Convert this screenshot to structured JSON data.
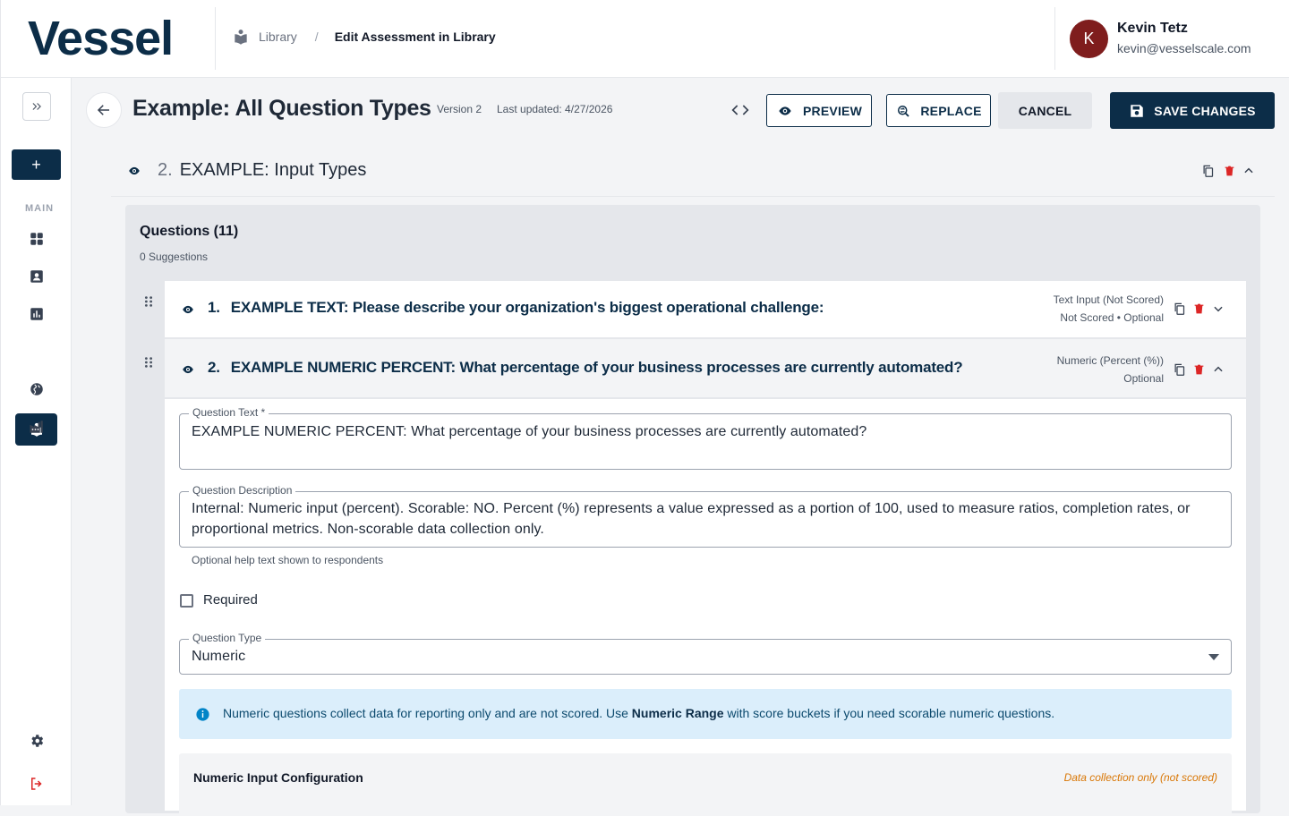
{
  "header": {
    "logo": "Vessel",
    "breadcrumb_library": "Library",
    "breadcrumb_separator": "/",
    "breadcrumb_current": "Edit Assessment in Library",
    "user_initial": "K",
    "user_name": "Kevin Tetz",
    "user_email": "kevin@vesselscale.com"
  },
  "sidebar": {
    "add_label": "+",
    "section_label": "MAIN",
    "items": [
      {
        "icon": "dashboard-icon",
        "active": false
      },
      {
        "icon": "contact-card-icon",
        "active": false
      },
      {
        "icon": "chart-icon",
        "active": false
      },
      {
        "icon": "library-icon",
        "active": true
      },
      {
        "icon": "globe-icon",
        "active": false
      },
      {
        "icon": "factory-icon",
        "active": false
      }
    ],
    "bottom": [
      "settings-icon",
      "logout-icon"
    ]
  },
  "title_bar": {
    "title": "Example: All Question Types",
    "version": "Version 2",
    "last_updated": "Last updated: 4/27/2026",
    "preview_label": "PREVIEW",
    "replace_label": "REPLACE",
    "cancel_label": "CANCEL",
    "save_label": "SAVE CHANGES"
  },
  "section": {
    "number": "2.",
    "title": "EXAMPLE: Input Types"
  },
  "questions": {
    "heading": "Questions (11)",
    "suggestions": "0 Suggestions",
    "items": [
      {
        "number": "1.",
        "title": "EXAMPLE TEXT: Please describe your organization's biggest operational challenge:",
        "type": "Text Input (Not Scored)",
        "status": "Not Scored • Optional",
        "expanded": false
      },
      {
        "number": "2.",
        "title": "EXAMPLE NUMERIC PERCENT: What percentage of your business processes are currently automated?",
        "type": "Numeric (Percent (%))",
        "status": "Optional",
        "expanded": true
      }
    ]
  },
  "form": {
    "question_text_label": "Question Text *",
    "question_text_value": "EXAMPLE NUMERIC PERCENT: What percentage of your business processes are currently automated?",
    "description_label": "Question Description",
    "description_value": "Internal: Numeric input (percent). Scorable: NO. Percent (%) represents a value expressed as a portion of 100, used to measure ratios, completion rates, or proportional metrics. Non-scorable data collection only.",
    "description_helper": "Optional help text shown to respondents",
    "required_label": "Required",
    "required_checked": false,
    "type_label": "Question Type",
    "type_value": "Numeric",
    "info_before": "Numeric questions collect data for reporting only and are not scored. Use ",
    "info_bold": "Numeric Range",
    "info_after": " with score buckets if you need scorable numeric questions.",
    "config_title": "Numeric Input Configuration",
    "config_note": "Data collection only (not scored)"
  },
  "colors": {
    "brand": "#0c2d48",
    "danger": "#dc2626",
    "info_bg": "#dbeefb",
    "warning_text": "#d97706"
  }
}
